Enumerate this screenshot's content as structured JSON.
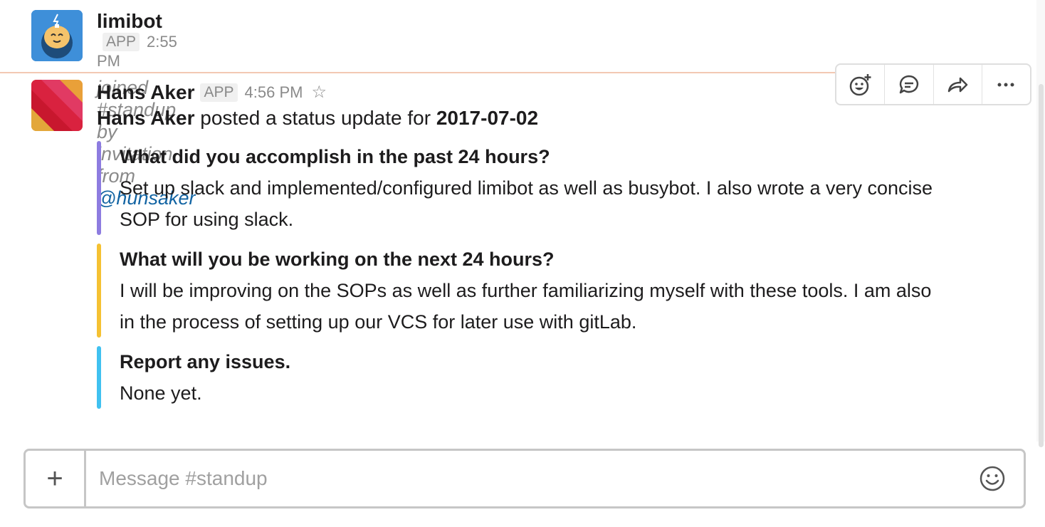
{
  "messages": [
    {
      "author": "limibot",
      "badge": "APP",
      "time": "2:55 PM",
      "text": "joined #standup by invitation from ",
      "mention": "@hunsaker"
    },
    {
      "author": "Hans Aker",
      "badge": "APP",
      "time": "4:56 PM",
      "status_author": "Hans Aker",
      "status_text": " posted a status update for ",
      "status_date": "2017-07-02",
      "attachments": [
        {
          "color": "#8d7ce0",
          "title": "What did you accomplish in the past 24 hours?",
          "text": "Set up slack and implemented/configured limibot as well as busybot. I also wrote a very concise SOP for using slack."
        },
        {
          "color": "#f5c132",
          "title": "What will you be working on the next 24 hours?",
          "text": "I will be improving on the SOPs as well as further familiarizing myself with these tools. I am also in the process of setting up our VCS for later use with gitLab."
        },
        {
          "color": "#40c1f0",
          "title": "Report any issues.",
          "text": "None yet."
        }
      ]
    }
  ],
  "toolbar": {
    "icons": [
      "add-reaction-icon",
      "start-thread-icon",
      "share-message-icon",
      "more-actions-icon"
    ]
  },
  "composer": {
    "plus_label": "+",
    "placeholder": "Message #standup"
  }
}
